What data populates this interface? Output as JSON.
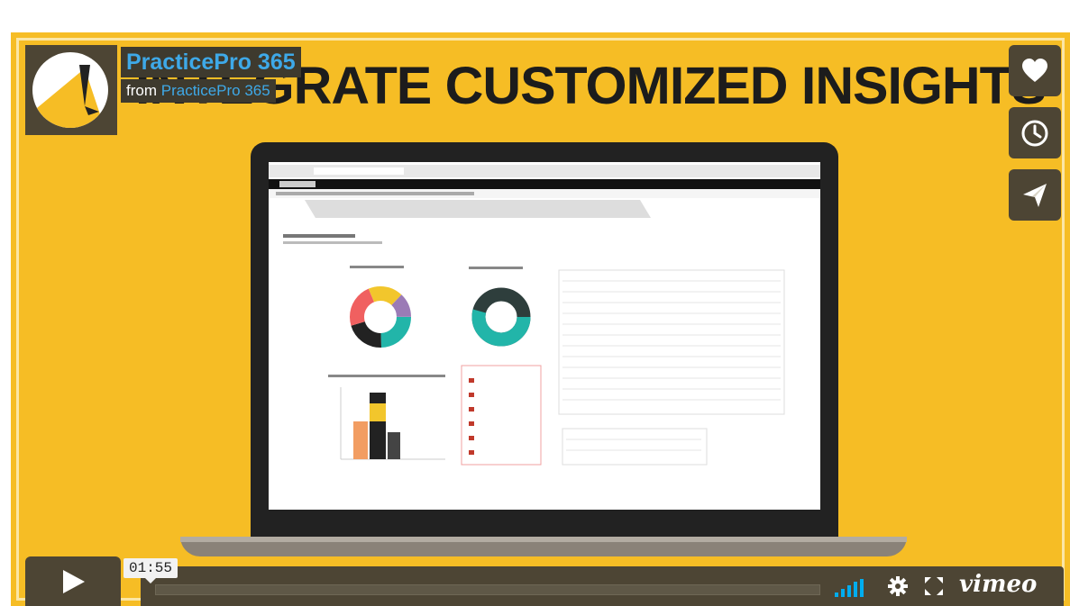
{
  "video": {
    "headline": "INTEGRATE CUSTOMIZED INSIGHTS",
    "title": "PracticePro 365",
    "from_prefix": "from",
    "author": "PracticePro 365",
    "timestamp": "01:55"
  },
  "colors": {
    "background": "#f6bd25",
    "overlay": "#4d4534",
    "accent_blue": "#3ea9e8",
    "volume_teal": "#00adef"
  },
  "side_buttons": [
    {
      "icon": "heart-icon",
      "label": "Like"
    },
    {
      "icon": "clock-icon",
      "label": "Watch Later"
    },
    {
      "icon": "send-icon",
      "label": "Share"
    }
  ],
  "controls": {
    "play_icon": "play-icon",
    "volume_icon": "volume-bars-icon",
    "settings_icon": "gear-icon",
    "fullscreen_icon": "fullscreen-icon",
    "brand": "vimeo"
  }
}
